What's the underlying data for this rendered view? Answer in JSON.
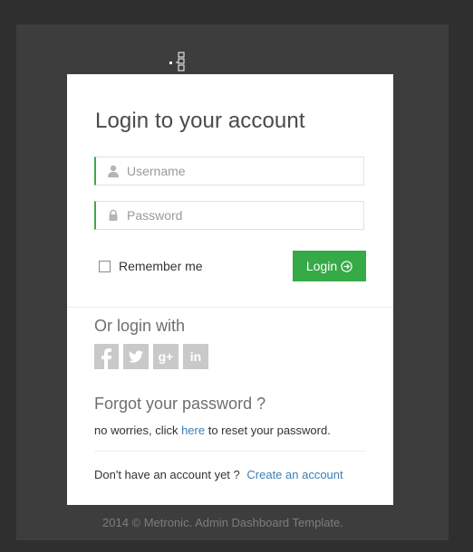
{
  "login": {
    "title": "Login to your account",
    "username_placeholder": "Username",
    "password_placeholder": "Password",
    "remember_label": "Remember me",
    "login_button": "Login"
  },
  "social": {
    "heading": "Or login with",
    "icons": [
      "facebook-icon",
      "twitter-icon",
      "googleplus-icon",
      "linkedin-icon"
    ],
    "labels": [
      "f",
      "",
      "g+",
      "in"
    ]
  },
  "forgot": {
    "heading": "Forgot your password ?",
    "prefix": "no worries, click ",
    "link": "here",
    "suffix": " to reset your password."
  },
  "signup": {
    "prompt": "Don't have an account yet ?",
    "link": "Create an account"
  },
  "footer": {
    "copyright": "2014 © Metronic. Admin Dashboard Template."
  },
  "colors": {
    "accent": "#35aa47",
    "link": "#3a7fb8",
    "background": "#2f2f2f",
    "panel": "#3d3d3d"
  }
}
